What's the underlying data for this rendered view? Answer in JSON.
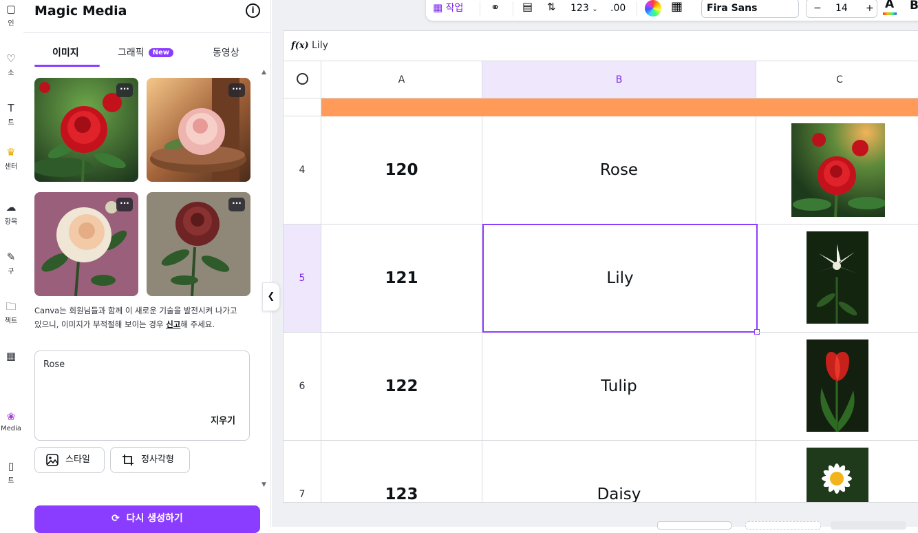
{
  "rail": {
    "items": [
      {
        "label": "인",
        "icon": "design-icon"
      },
      {
        "label": "소",
        "icon": "elements-icon"
      },
      {
        "label": "트",
        "icon": "text-icon"
      },
      {
        "label": "센터",
        "icon": "brand-icon"
      },
      {
        "label": "항목",
        "icon": "uploads-icon"
      },
      {
        "label": "구",
        "icon": "draw-icon"
      },
      {
        "label": "젝트",
        "icon": "projects-icon"
      },
      {
        "label": "",
        "icon": "apps-icon"
      },
      {
        "label": "Media",
        "icon": "magic-media-icon"
      },
      {
        "label": "트",
        "icon": "charts-icon"
      }
    ]
  },
  "panel": {
    "title": "Magic Media",
    "tabs": [
      {
        "label": "이미지"
      },
      {
        "label": "그래픽",
        "badge": "New"
      },
      {
        "label": "동영상"
      }
    ],
    "images": [
      {
        "subject": "red rose"
      },
      {
        "subject": "pink rose"
      },
      {
        "subject": "white rose"
      },
      {
        "subject": "dark red rose"
      }
    ],
    "more_glyph": "···",
    "disclaimer_before": "Canva는 회원님들과 함께 이 새로운 기술을 발전시켜 나가고 있으니, 이미지가 부적절해 보이는 경우 ",
    "disclaimer_link": "신고",
    "disclaimer_after": "해 주세요.",
    "prompt_text": "Rose",
    "clear_label": "지우기",
    "style_label": "스타일",
    "aspect_label": "정사각형",
    "regenerate_label": "다시 생성하기"
  },
  "toolbar": {
    "action_label": "작업",
    "number_format": "123",
    "decimal_label": ".00",
    "font_name": "Fira Sans",
    "font_size": "14",
    "minus": "−",
    "plus": "+",
    "text_color_glyph": "A",
    "bold_glyph": "B"
  },
  "sheet": {
    "formula_label": "f(x)",
    "formula_value": "Lily",
    "columns": [
      "A",
      "B",
      "C"
    ],
    "selected_column": "B",
    "colors": {
      "header_row": "#ff9a58",
      "selection": "#8b3dff",
      "accent": "#8b3dff"
    },
    "rows": [
      {
        "row": "4",
        "id": "120",
        "name": "Rose",
        "image": "red rose"
      },
      {
        "row": "5",
        "id": "121",
        "name": "Lily",
        "image": "white lily",
        "selected": true
      },
      {
        "row": "6",
        "id": "122",
        "name": "Tulip",
        "image": "red tulip"
      },
      {
        "row": "7",
        "id": "123",
        "name": "Daisy",
        "image": "daisy"
      }
    ]
  }
}
